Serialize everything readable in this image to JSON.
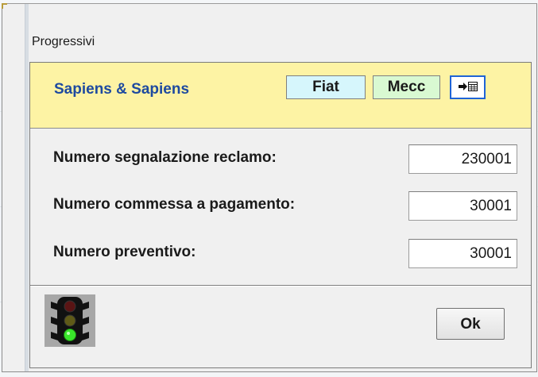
{
  "window": {
    "title": "Progressivi"
  },
  "header": {
    "company": "Sapiens & Sapiens",
    "chips": [
      {
        "label": "Fiat",
        "color": "#d6f6fc"
      },
      {
        "label": "Mecc",
        "color": "#d9f9d2"
      }
    ],
    "export_icon": "export-to-table-icon",
    "background": "#fdf3a4",
    "company_color": "#1e4aa0"
  },
  "form": {
    "rows": [
      {
        "label": "Numero segnalazione reclamo:",
        "value": "230001"
      },
      {
        "label": "Numero commessa a pagamento:",
        "value": "30001"
      },
      {
        "label": "Numero preventivo:",
        "value": "30001"
      }
    ]
  },
  "footer": {
    "status_icon": "traffic-light-icon",
    "status_light": "green",
    "ok_label": "Ok"
  }
}
